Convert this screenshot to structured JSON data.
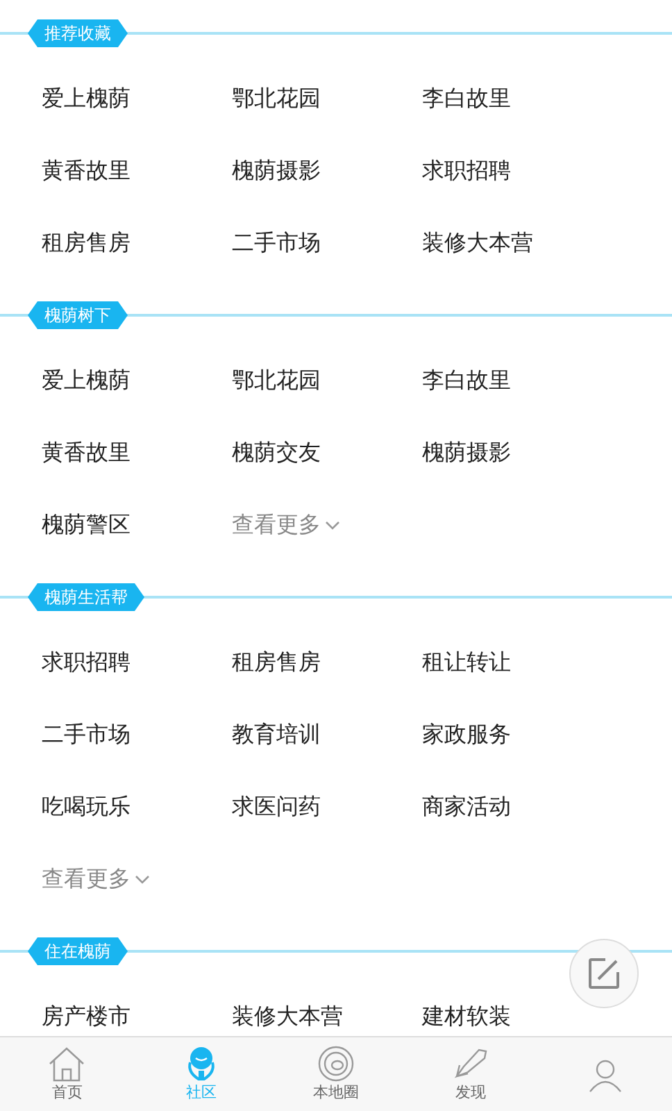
{
  "sections": [
    {
      "title": "推荐收藏",
      "items": [
        {
          "kind": "link",
          "label": "爱上槐荫"
        },
        {
          "kind": "link",
          "label": "鄂北花园"
        },
        {
          "kind": "link",
          "label": "李白故里"
        },
        {
          "kind": "link",
          "label": "黄香故里"
        },
        {
          "kind": "link",
          "label": "槐荫摄影"
        },
        {
          "kind": "link",
          "label": "求职招聘"
        },
        {
          "kind": "link",
          "label": "租房售房"
        },
        {
          "kind": "link",
          "label": "二手市场"
        },
        {
          "kind": "link",
          "label": "装修大本营"
        }
      ]
    },
    {
      "title": "槐荫树下",
      "items": [
        {
          "kind": "link",
          "label": "爱上槐荫"
        },
        {
          "kind": "link",
          "label": "鄂北花园"
        },
        {
          "kind": "link",
          "label": "李白故里"
        },
        {
          "kind": "link",
          "label": "黄香故里"
        },
        {
          "kind": "link",
          "label": "槐荫交友"
        },
        {
          "kind": "link",
          "label": "槐荫摄影"
        },
        {
          "kind": "link",
          "label": "槐荫警区"
        },
        {
          "kind": "more",
          "label": "查看更多"
        }
      ]
    },
    {
      "title": "槐荫生活帮",
      "items": [
        {
          "kind": "link",
          "label": "求职招聘"
        },
        {
          "kind": "link",
          "label": "租房售房"
        },
        {
          "kind": "link",
          "label": "租让转让"
        },
        {
          "kind": "link",
          "label": "二手市场"
        },
        {
          "kind": "link",
          "label": "教育培训"
        },
        {
          "kind": "link",
          "label": "家政服务"
        },
        {
          "kind": "link",
          "label": "吃喝玩乐"
        },
        {
          "kind": "link",
          "label": "求医问药"
        },
        {
          "kind": "link",
          "label": "商家活动"
        },
        {
          "kind": "more",
          "label": "查看更多"
        }
      ]
    },
    {
      "title": "住在槐荫",
      "items": [
        {
          "kind": "link",
          "label": "房产楼市"
        },
        {
          "kind": "link",
          "label": "装修大本营"
        },
        {
          "kind": "link",
          "label": "建材软装"
        }
      ]
    }
  ],
  "tabbar": [
    {
      "kind": "home",
      "label": "首页",
      "selected": false
    },
    {
      "kind": "community",
      "label": "社区",
      "selected": true
    },
    {
      "kind": "local",
      "label": "本地圈",
      "selected": false
    },
    {
      "kind": "discover",
      "label": "发现",
      "selected": false
    },
    {
      "kind": "user",
      "selected": false
    }
  ]
}
